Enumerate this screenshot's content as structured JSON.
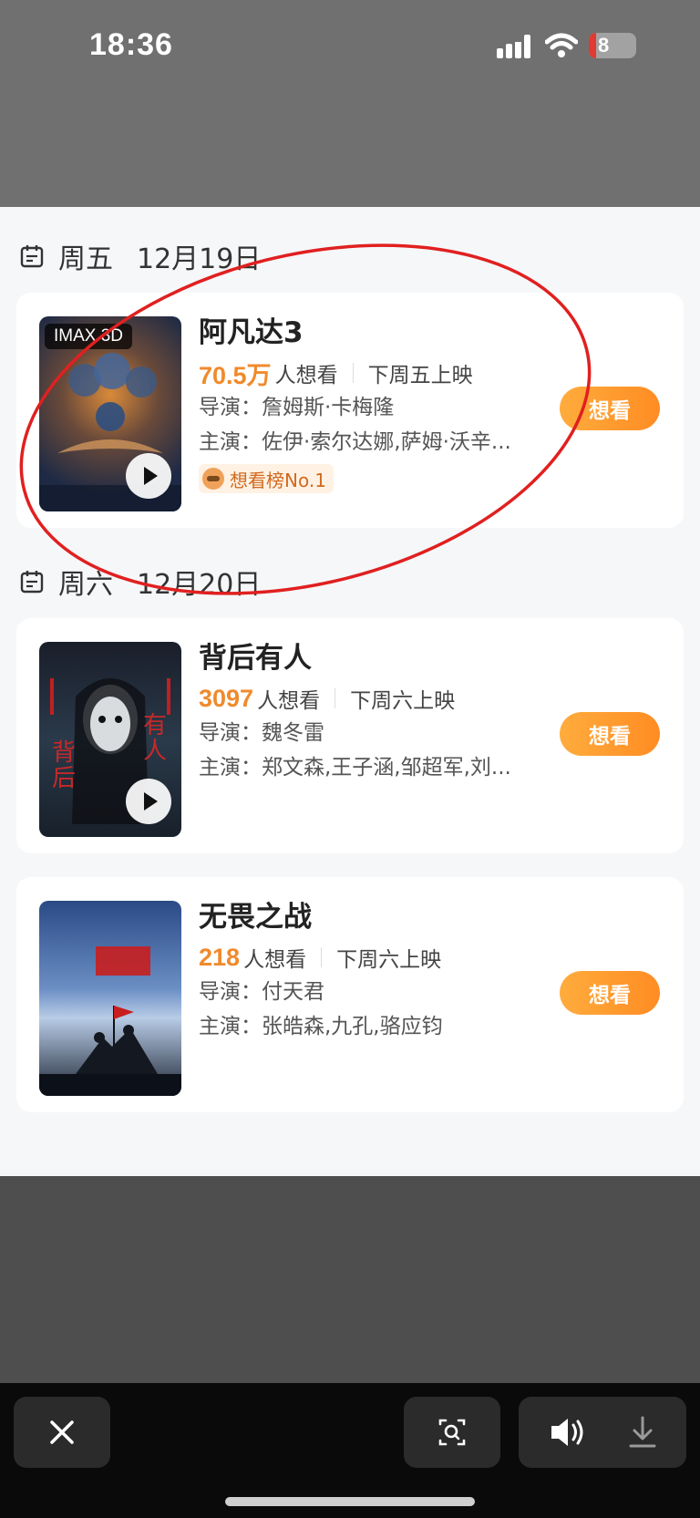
{
  "status_bar": {
    "time": "18:36",
    "battery": "8"
  },
  "sections": [
    {
      "weekday": "周五",
      "date": "12月19日"
    },
    {
      "weekday": "周六",
      "date": "12月20日"
    }
  ],
  "movies": [
    {
      "title": "阿凡达3",
      "want_count": "70.5万",
      "want_text": "人想看",
      "release": "下周五上映",
      "director": "导演：詹姆斯·卡梅隆",
      "cast": "主演：佐伊·索尔达娜,萨姆·沃辛...",
      "poster_badge": "IMAX 3D",
      "rank_tag": "想看榜No.1",
      "button": "想看",
      "poster_colors": [
        "#2b3a5a",
        "#c06a2a"
      ]
    },
    {
      "title": "背后有人",
      "want_count": "3097",
      "want_text": "人想看",
      "release": "下周六上映",
      "director": "导演：魏冬雷",
      "cast": "主演：郑文森,王子涵,邹超军,刘...",
      "button": "想看",
      "poster_colors": [
        "#1b2a3a",
        "#8a2a2a"
      ]
    },
    {
      "title": "无畏之战",
      "want_count": "218",
      "want_text": "人想看",
      "release": "下周六上映",
      "director": "导演：付天君",
      "cast": "主演：张皓森,九孔,骆应钧",
      "button": "想看",
      "poster_colors": [
        "#2a4a7a",
        "#8cb0d8"
      ]
    }
  ],
  "colors": {
    "accent_orange": "#f08a2c",
    "button_gradient": [
      "#ffac3d",
      "#ff8c23"
    ],
    "annotation_red": "#e02020"
  },
  "icons": {
    "close": "close-icon",
    "scan": "scan-search-icon",
    "sound": "speaker-icon",
    "download": "download-icon"
  }
}
